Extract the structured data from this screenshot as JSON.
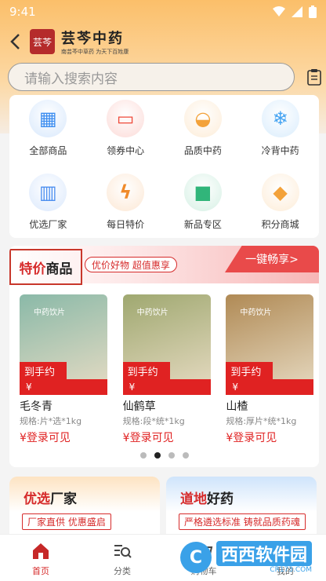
{
  "status_bar": {
    "time": "9:41"
  },
  "nav": {
    "brand_name": "芸芩中药",
    "brand_sub": "南芸芩中草药 为天下百姓康",
    "logo_text": "芸芩"
  },
  "search": {
    "placeholder": "请输入搜索内容"
  },
  "categories": [
    {
      "label": "全部商品",
      "icon": "grid-icon",
      "color": "#3d8ef0"
    },
    {
      "label": "领券中心",
      "icon": "coupon-icon",
      "color": "#ef4a3a"
    },
    {
      "label": "品质中药",
      "icon": "herb-pot-icon",
      "color": "#f3a23a"
    },
    {
      "label": "冷背中药",
      "icon": "snowflake-icon",
      "color": "#46a4f2"
    },
    {
      "label": "优选厂家",
      "icon": "building-icon",
      "color": "#4c8ff0"
    },
    {
      "label": "每日特价",
      "icon": "lightning-icon",
      "color": "#f08a2a"
    },
    {
      "label": "新品专区",
      "icon": "new-badge-icon",
      "color": "#31b57a"
    },
    {
      "label": "积分商城",
      "icon": "points-icon",
      "color": "#f3a23a"
    }
  ],
  "special": {
    "title_red": "特价",
    "title_dark": "商品",
    "tag": "优价好物 超值惠享",
    "more": "一键畅享>",
    "products": [
      {
        "price_label": "到手约",
        "price_symbol": "¥",
        "name": "毛冬青",
        "spec": "规格:片*选*1kg",
        "price_text": "¥登录可见",
        "img_label": "中药饮片",
        "img_color": "#8ab9a8"
      },
      {
        "price_label": "到手约",
        "price_symbol": "¥",
        "name": "仙鹤草",
        "spec": "规格:段*统*1kg",
        "price_text": "¥登录可见",
        "img_label": "中药饮片",
        "img_color": "#9fa870"
      },
      {
        "price_label": "到手约",
        "price_symbol": "¥",
        "name": "山楂",
        "spec": "规格:厚片*统*1kg",
        "price_text": "¥登录可见",
        "img_label": "中药饮片",
        "img_color": "#b08a55"
      }
    ],
    "carousel_pages": 4,
    "carousel_active": 2
  },
  "bottom_cards": {
    "left": {
      "title_red": "优选",
      "title_dark": "厂家",
      "tag": "厂家直供 优惠盛启"
    },
    "right": {
      "title_red": "道地",
      "title_dark": "好药",
      "tag": "严格遴选标准 铸就品质药魂"
    }
  },
  "tabs": [
    {
      "label": "首页",
      "icon": "home-icon",
      "active": true
    },
    {
      "label": "分类",
      "icon": "category-search-icon",
      "active": false
    },
    {
      "label": "购物车",
      "icon": "cart-icon",
      "active": false
    },
    {
      "label": "我的",
      "icon": "user-icon",
      "active": false
    }
  ],
  "watermark": {
    "main": "西西软件园",
    "sub": "CR173.COM"
  }
}
